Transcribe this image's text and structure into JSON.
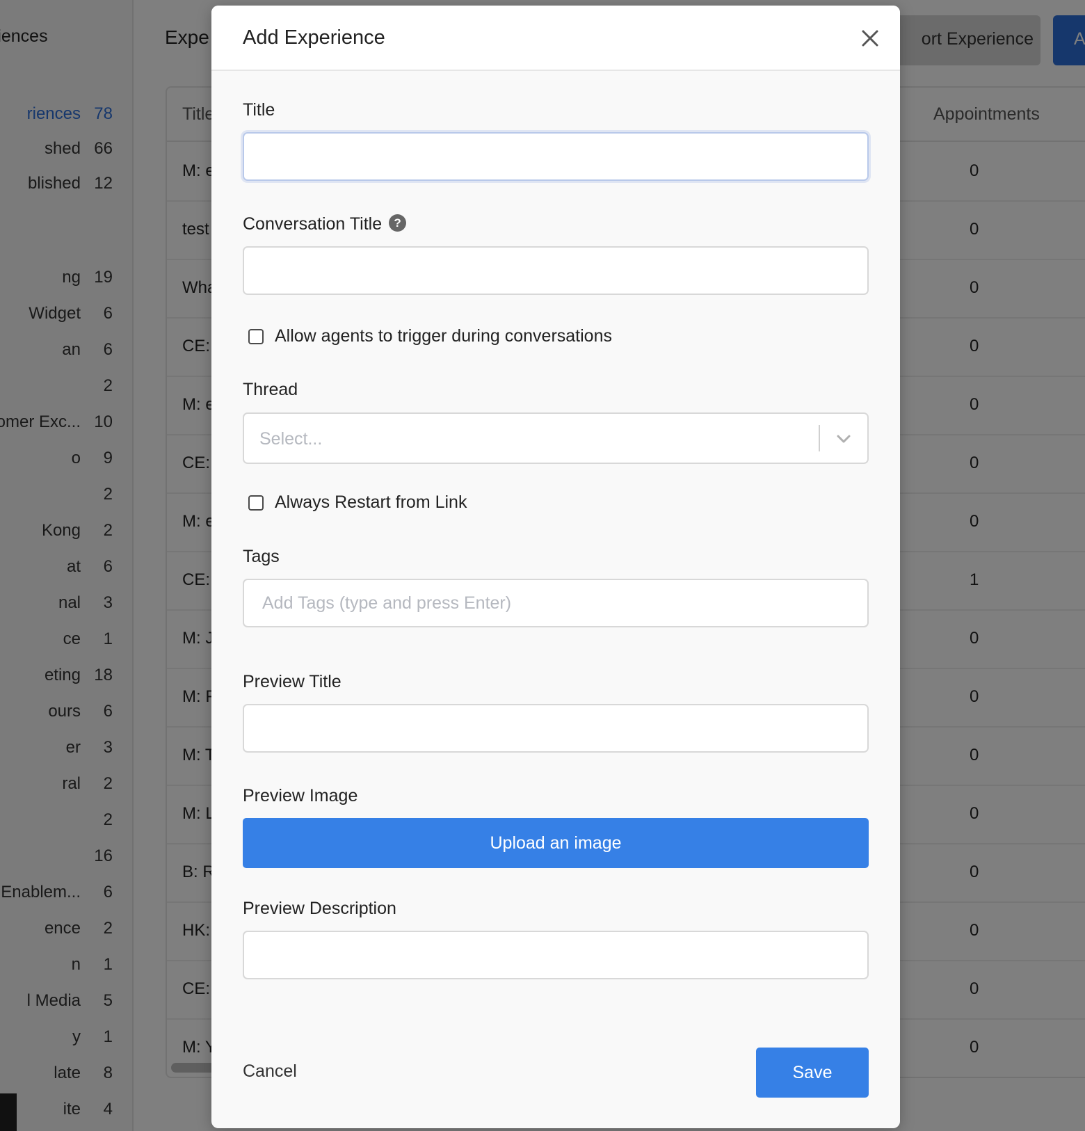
{
  "sidebar": {
    "title": "riences",
    "items": [
      {
        "label": "riences",
        "count": "78",
        "active": true
      },
      {
        "label": "shed",
        "count": "66"
      },
      {
        "label": "blished",
        "count": "12"
      },
      {
        "label": "ng",
        "count": "19"
      },
      {
        "label": "Widget",
        "count": "6"
      },
      {
        "label": "an",
        "count": "6"
      },
      {
        "label": "",
        "count": "2"
      },
      {
        "label": "omer Exc...",
        "count": "10"
      },
      {
        "label": "o",
        "count": "9"
      },
      {
        "label": "",
        "count": "2"
      },
      {
        "label": "Kong",
        "count": "2"
      },
      {
        "label": "at",
        "count": "6"
      },
      {
        "label": "nal",
        "count": "3"
      },
      {
        "label": "ce",
        "count": "1"
      },
      {
        "label": "eting",
        "count": "18"
      },
      {
        "label": "ours",
        "count": "6"
      },
      {
        "label": "er",
        "count": "3"
      },
      {
        "label": "ral",
        "count": "2"
      },
      {
        "label": "",
        "count": "2"
      },
      {
        "label": "",
        "count": "16"
      },
      {
        "label": "Enablem...",
        "count": "6"
      },
      {
        "label": "ence",
        "count": "2"
      },
      {
        "label": "n",
        "count": "1"
      },
      {
        "label": "l Media",
        "count": "5"
      },
      {
        "label": "y",
        "count": "1"
      },
      {
        "label": "late",
        "count": "8"
      },
      {
        "label": "ite",
        "count": "4"
      }
    ]
  },
  "main": {
    "title": "Expe",
    "import_label": "ort Experience",
    "add_label": "A",
    "table": {
      "col_title": "Title",
      "col_appointments": "Appointments",
      "rows": [
        {
          "title": "M: e",
          "appointments": "0"
        },
        {
          "title": "test",
          "appointments": "0"
        },
        {
          "title": "Wha",
          "appointments": "0"
        },
        {
          "title": "CE:",
          "appointments": "0"
        },
        {
          "title": "M: e",
          "appointments": "0"
        },
        {
          "title": "CE:",
          "appointments": "0"
        },
        {
          "title": "M: e",
          "appointments": "0"
        },
        {
          "title": "CE:",
          "appointments": "1"
        },
        {
          "title": "M: J",
          "appointments": "0"
        },
        {
          "title": "M: F",
          "appointments": "0"
        },
        {
          "title": "M: T",
          "appointments": "0"
        },
        {
          "title": "M: L",
          "appointments": "0"
        },
        {
          "title": "B: R",
          "appointments": "0"
        },
        {
          "title": "HK:",
          "appointments": "0"
        },
        {
          "title": "CE:",
          "appointments": "0"
        },
        {
          "title": "M: Y",
          "appointments": "0"
        }
      ]
    }
  },
  "modal": {
    "title": "Add Experience",
    "title_label": "Title",
    "title_value": "",
    "conversation_title_label": "Conversation Title",
    "help_glyph": "?",
    "conversation_title_value": "",
    "allow_agents_label": "Allow agents to trigger during conversations",
    "allow_agents_checked": false,
    "thread_label": "Thread",
    "thread_placeholder": "Select...",
    "always_restart_label": "Always Restart from Link",
    "always_restart_checked": false,
    "tags_label": "Tags",
    "tags_placeholder": "Add Tags (type and press Enter)",
    "preview_title_label": "Preview Title",
    "preview_title_value": "",
    "preview_image_label": "Preview Image",
    "upload_label": "Upload an image",
    "preview_description_label": "Preview Description",
    "preview_description_value": "",
    "cancel_label": "Cancel",
    "save_label": "Save"
  },
  "colors": {
    "primary": "#3680e6",
    "active_link": "#2d6fd9",
    "overlay": "rgba(0,0,0,0.5)"
  },
  "icons": {
    "close": "close-icon",
    "help": "help-icon",
    "chevron": "chevron-down-icon"
  }
}
